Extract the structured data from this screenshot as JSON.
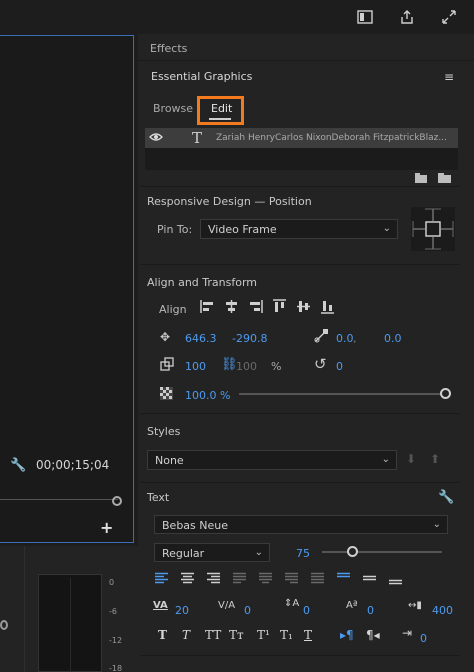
{
  "toolbar": {
    "icons": [
      "panel-icon",
      "export-icon",
      "fullscreen-icon"
    ]
  },
  "monitor": {
    "timecode": "00;00;15;04"
  },
  "audio_meter": {
    "ticks": [
      "0",
      "-6",
      "-12",
      "-18"
    ]
  },
  "panel": {
    "effects_label": "Effects",
    "title": "Essential Graphics",
    "tabs": {
      "browse": "Browse",
      "edit": "Edit"
    },
    "layer_text": "Zariah HenryCarlos NixonDeborah FitzpatrickBlaz...",
    "responsive": {
      "header": "Responsive Design — Position",
      "pin_label": "Pin To:",
      "pin_value": "Video Frame"
    },
    "align": {
      "header": "Align and Transform",
      "align_label": "Align",
      "pos_x": "646.3",
      "pos_y": "-290.8",
      "anchor_x": "0.0",
      "anchor_y": "0.0",
      "scale": "100",
      "scale_locked_value": "100",
      "scale_unit": "%",
      "rotation": "0",
      "opacity": "100.0 %",
      "opacity_level": 1.0
    },
    "styles": {
      "header": "Styles",
      "value": "None"
    },
    "text": {
      "header": "Text",
      "font": "Bebas Neue",
      "weight": "Regular",
      "size": "75",
      "size_level": 0.25,
      "tracking": "20",
      "kerning": "0",
      "leading": "0",
      "baseline": "0",
      "tsume": "400"
    }
  },
  "colors": {
    "accent_blue": "#4d9bf0",
    "highlight_orange": "#f47a20",
    "panel_bg": "#232323"
  }
}
